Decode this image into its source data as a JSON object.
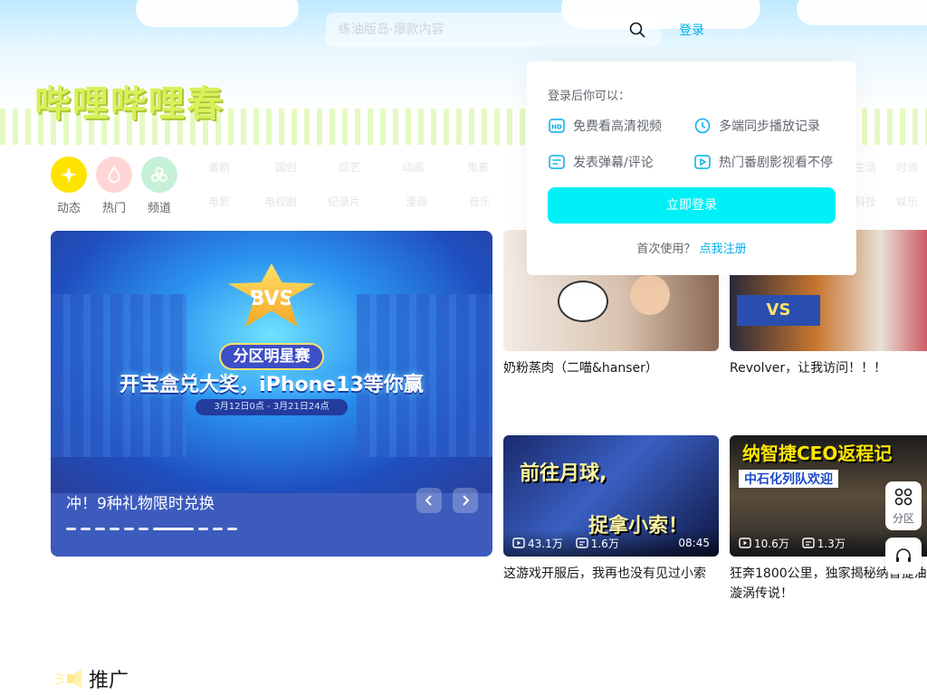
{
  "header": {
    "banner_title": "哔哩哔哩春",
    "search_placeholder": "练油版岛·爆款内容",
    "login_label": "登录"
  },
  "entries": [
    {
      "label": "动态",
      "color": "#ffe300",
      "icon": "dynamic-icon"
    },
    {
      "label": "热门",
      "color": "#ffd6d6",
      "icon": "fire-icon"
    },
    {
      "label": "频道",
      "color": "#c7f0d8",
      "icon": "channel-icon"
    }
  ],
  "faint_channels_row1": [
    "番剧",
    "国创",
    "综艺",
    "动画",
    "鬼畜"
  ],
  "faint_channels_row2": [
    "电影",
    "电视剧",
    "纪录片",
    "漫画",
    "音乐"
  ],
  "faint_right": [
    "生活",
    "时尚"
  ],
  "faint_right2": [
    "科技",
    "娱乐"
  ],
  "carousel": {
    "logo_text": "BVS",
    "badge": "分区明星赛",
    "headline": "开宝盒兑大奖，iPhone13等你赢",
    "date": "3月12日0点 - 3月21日24点",
    "caption": "冲！9种礼物限时兑换",
    "dot_count": 10,
    "active_dot": 7
  },
  "cards_top": [
    {
      "title": "奶粉蒸肉（二喵&hanser）"
    },
    {
      "title": "Revolver，让我访问！！！"
    }
  ],
  "cards_bottom": [
    {
      "title": "这游戏开服后，我再也没有见过小索",
      "views": "43.1万",
      "danmaku": "1.6万",
      "duration": "08:45",
      "thumb_text1": "前往月球,",
      "thumb_text2": "捉拿小索！"
    },
    {
      "title": "狂奔1800公里，独家揭秘纳智捷油箱漩涡传说！",
      "views": "10.6万",
      "danmaku": "1.3万",
      "duration": "",
      "thumb_text1": "纳智捷CEO返程记",
      "thumb_text2": "中石化列队欢迎"
    }
  ],
  "login_popover": {
    "title": "登录后你可以：",
    "benefits": [
      {
        "text": "免费看高清视频",
        "icon": "hd-icon"
      },
      {
        "text": "多端同步播放记录",
        "icon": "clock-icon"
      },
      {
        "text": "发表弹幕/评论",
        "icon": "comment-icon"
      },
      {
        "text": "热门番剧影视看不停",
        "icon": "play-icon"
      }
    ],
    "button": "立即登录",
    "first_use": "首次使用？",
    "register": "点我注册"
  },
  "float": {
    "partition_label": "分区"
  },
  "section": {
    "title": "推广"
  },
  "colors": {
    "accent": "#00aeec",
    "login_button": "#00f0f7",
    "text_secondary": "#61666d"
  }
}
